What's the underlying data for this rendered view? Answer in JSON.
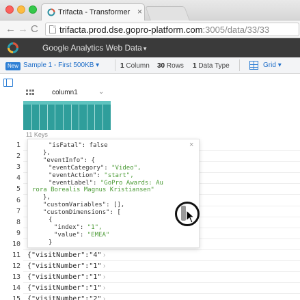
{
  "browser": {
    "tab_title": "Trifacta - Transformer",
    "tab_close": "×",
    "url_host": "trifacta.prod.dse.gopro-platform.com",
    "url_path": ":3005/data/33/33",
    "back_glyph": "←",
    "forward_glyph": "→",
    "reload_glyph": "C"
  },
  "app": {
    "dataset_title": "Google Analytics Web Data",
    "dataset_caret": "▾"
  },
  "toolbar": {
    "new_badge": "New",
    "sample_label": "Sample 1 - First 500KB",
    "sample_caret": "▾",
    "columns_count": "1",
    "columns_label": "Column",
    "rows_count": "30",
    "rows_label": "Rows",
    "types_count": "1",
    "types_label": "Data Type",
    "view_label": "Grid",
    "view_caret": "▾"
  },
  "column": {
    "name": "column1",
    "menu_caret": "⌄",
    "keys_label": "11 Keys"
  },
  "popup": {
    "close": "×",
    "lines": [
      "\"isFatal\": false",
      "},",
      "\"eventInfo\": {",
      "\"eventCategory\": \"Video\",",
      "\"eventAction\": \"start\",",
      "\"eventLabel\": \"GoPro Awards: Au",
      "rora Borealis Magnus Kristiansen\"",
      "},",
      "\"customVariables\": [],",
      "\"customDimensions\": [",
      "{",
      "\"index\": \"1\",",
      "\"value\": \"EMEA\"",
      "}"
    ]
  },
  "rows": {
    "numbers": [
      "1",
      "2",
      "3",
      "4",
      "5",
      "6",
      "7",
      "8",
      "9",
      "10",
      "11",
      "12",
      "13",
      "14",
      "15"
    ],
    "visible_cells": [
      "{\"visitNumber\":\"4\"",
      "{\"visitNumber\":\"1\"",
      "{\"visitNumber\":\"1\"",
      "{\"visitNumber\":\"1\"",
      "{\"visitNumber\":\"2\""
    ],
    "expand_caret": "›"
  },
  "icons": {
    "favicon": "trifacta-logo-icon",
    "app_logo": "trifacta-wheel-icon",
    "grid": "grid-icon",
    "rail": "panel-toggle-icon",
    "column_type": "object-type-icon",
    "cursor": "mouse-cursor-icon"
  },
  "colors": {
    "app_header": "#3a3a3a",
    "accent": "#2e7fd5",
    "histogram": "#2f9e9b",
    "json_string": "#4a9a34"
  }
}
